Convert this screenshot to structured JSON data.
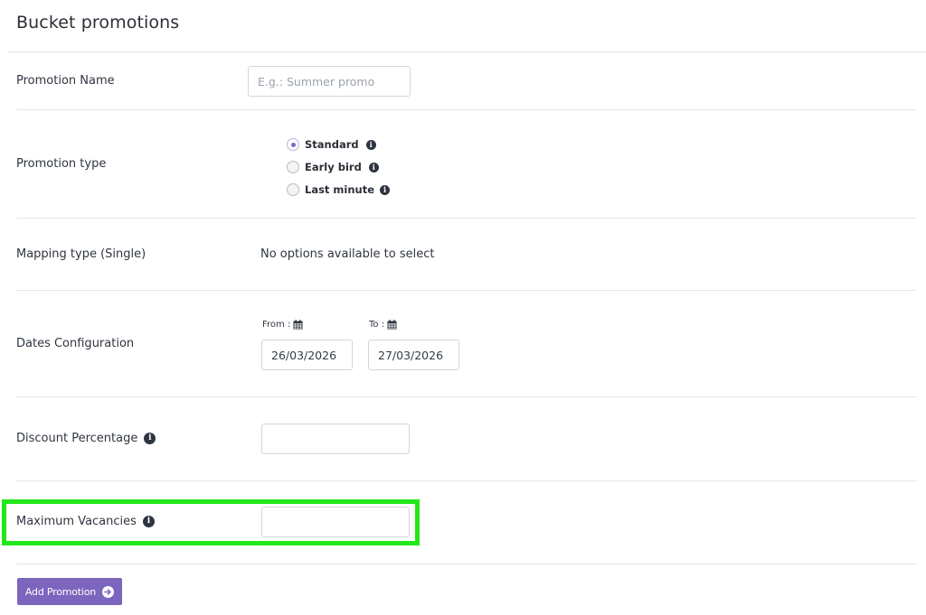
{
  "page": {
    "title": "Bucket promotions"
  },
  "promotion_name": {
    "label": "Promotion Name",
    "placeholder": "E.g.: Summer promo",
    "value": ""
  },
  "promotion_type": {
    "label": "Promotion type",
    "options": [
      {
        "label": "Standard",
        "selected": true
      },
      {
        "label": "Early bird",
        "selected": false
      },
      {
        "label": "Last minute",
        "selected": false
      }
    ]
  },
  "mapping_type": {
    "label": "Mapping type (Single)",
    "message": "No options available to select"
  },
  "dates": {
    "label": "Dates Configuration",
    "from_label": "From :",
    "to_label": "To :",
    "from_value": "26/03/2026",
    "to_value": "27/03/2026"
  },
  "discount": {
    "label": "Discount Percentage",
    "value": ""
  },
  "vacancies": {
    "label": "Maximum Vacancies",
    "value": ""
  },
  "actions": {
    "add_label": "Add Promotion"
  },
  "colors": {
    "accent": "#7b65bd",
    "highlight": "#22e81a",
    "divider": "#e3e5e8"
  }
}
